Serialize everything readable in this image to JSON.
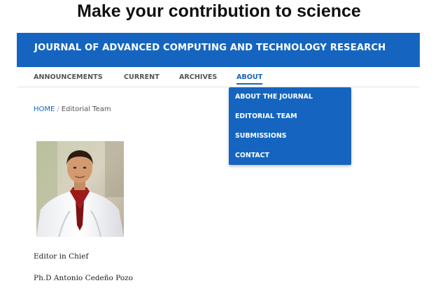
{
  "banner": {
    "title": "Make your contribution to science"
  },
  "header": {
    "site_name": "JOURNAL OF ADVANCED COMPUTING AND TECHNOLOGY RESEARCH",
    "bg_color": "#1565c0"
  },
  "nav": {
    "items": [
      {
        "label": "ANNOUNCEMENTS"
      },
      {
        "label": "CURRENT"
      },
      {
        "label": "ARCHIVES"
      },
      {
        "label": "ABOUT",
        "active": true
      }
    ]
  },
  "about_menu": {
    "items": [
      {
        "label": "ABOUT THE JOURNAL"
      },
      {
        "label": "EDITORIAL TEAM"
      },
      {
        "label": "SUBMISSIONS"
      },
      {
        "label": "CONTACT"
      }
    ]
  },
  "breadcrumb": {
    "home": "HOME",
    "separator": "/",
    "current": "Editorial Team"
  },
  "editor": {
    "role": "Editor in Chief",
    "name": "Ph.D Antonio Cedeño Pozo",
    "photo_icon": "editor-portrait"
  }
}
